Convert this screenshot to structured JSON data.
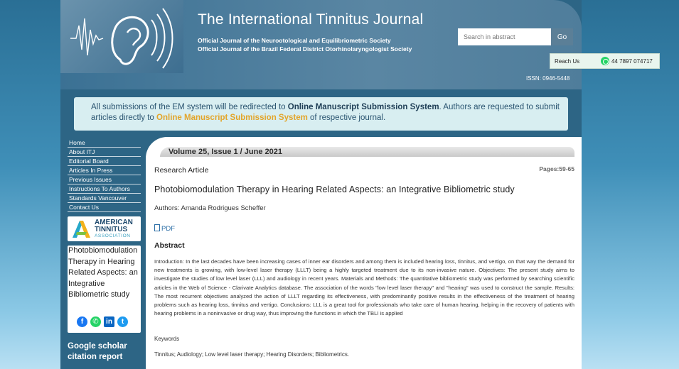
{
  "header": {
    "title": "The International Tinnitus Journal",
    "subtitle_1": "Official Journal of the Neurootological and Equilibriometric Society",
    "subtitle_2": "Official Journal of the Brazil Federal District Otorhinolaryngologist Society",
    "search_placeholder": "Search in abstract",
    "go_label": "Go",
    "reach_label": "Reach Us",
    "reach_phone": "44 7897 074717",
    "issn": "ISSN: 0946-5448"
  },
  "notice": {
    "text_1": "All submissions of the EM system will be redirected to ",
    "link_1": "Online Manuscript Submission System",
    "text_2": ". Authors are requested to submit articles directly to ",
    "link_2": "Online Manuscript Submission System",
    "text_3": " of respective journal."
  },
  "sidebar": {
    "items": [
      {
        "label": "Home"
      },
      {
        "label": "About ITJ"
      },
      {
        "label": "Editorial Board"
      },
      {
        "label": "Articles In Press"
      },
      {
        "label": "Previous Issues"
      },
      {
        "label": "Instructions To Authors"
      },
      {
        "label": "Standards Vancouver"
      },
      {
        "label": "Contact Us"
      }
    ],
    "ata_line1": "AMERICAN",
    "ata_line2": "TINNITUS",
    "ata_line3": "ASSOCIATION",
    "alt_image_text": "Photobiomodulation Therapy in Hearing Related Aspects: an Integrative Bibliometric study",
    "google_scholar": "Google scholar citation report"
  },
  "article": {
    "volume": "Volume 25, Issue 1 / June 2021",
    "type": "Research Article",
    "pages": "Pages:59-65",
    "title": "Photobiomodulation Therapy in Hearing Related Aspects: an Integrative Bibliometric study",
    "authors": "Authors: Amanda Rodrigues Scheffer",
    "pdf_label": "PDF",
    "abstract_heading": "Abstract",
    "abstract": "Introduction: In the last decades have been increasing cases of inner ear disorders and among them is included hearing loss, tinnitus, and vertigo, on that way the demand for new treatments is growing, with low-level laser therapy (LLLT) being a highly targeted treatment due to its non-invasive nature. Objectives: The present study aims to investigate the studies of low level laser (LLL) and audiology in recent years. Materials and Methods: The quantitative bibliometric study was performed by searching scientific articles in the Web of Science - Clarivate Analytics database. The association of the words \"low level laser therapy\" and \"hearing\" was used to construct the sample. Results: The most recurrent objectives analyzed the action of LLLT regarding its effectiveness, with predominantly positive results in the effectiveness of the treatment of hearing problems such as hearing loss, tinnitus and vertigo. Conclusions: LLL is a great tool for professionals who take care of human hearing, helping in the recovery of patients with hearing problems in a noninvasive or drug way, thus improving the functions in which the TBLI is applied",
    "keywords_heading": "Keywords",
    "keywords": "Tinnitus; Audiology; Low level laser therapy; Hearing Disorders; Bibliometrics."
  },
  "icons": {
    "logo": "ear-soundwave-logo",
    "social": [
      "facebook-icon",
      "whatsapp-icon",
      "linkedin-icon",
      "twitter-icon"
    ]
  },
  "colors": {
    "accent_gold": "#e3a52a",
    "notice_bg": "#d8eef1",
    "header_bg": "#3b7194"
  }
}
